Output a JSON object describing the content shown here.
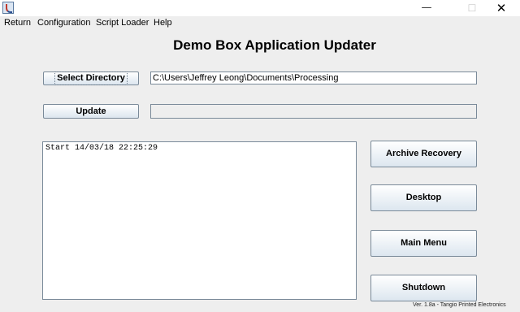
{
  "window": {
    "title": "",
    "minimize_glyph": "—",
    "maximize_glyph": "☐",
    "close_glyph": "✕"
  },
  "menu": {
    "items": [
      "Return",
      "Configuration",
      "Script Loader",
      "Help"
    ]
  },
  "heading": "Demo Box Application Updater",
  "directory": {
    "button_label": "Select Directory",
    "path": "C:\\Users\\Jeffrey Leong\\Documents\\Processing"
  },
  "update": {
    "button_label": "Update",
    "status": ""
  },
  "log": {
    "text": "Start 14/03/18 22:25:29"
  },
  "actions": {
    "archive_recovery": "Archive Recovery",
    "desktop": "Desktop",
    "main_menu": "Main Menu",
    "shutdown": "Shutdown"
  },
  "footer": {
    "version": "Ver. 1.8a - Tangio Printed Electronics"
  }
}
